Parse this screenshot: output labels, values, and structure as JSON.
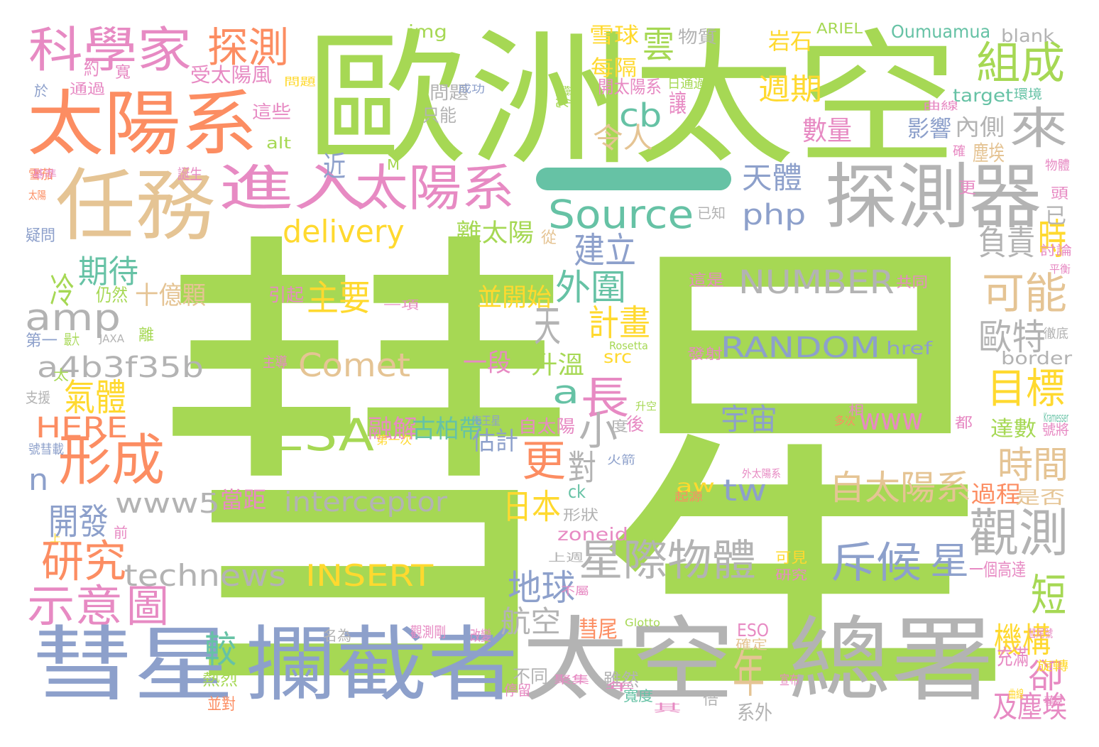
{
  "palette": {
    "green": "#a6d854",
    "teal": "#66c2a5",
    "orange": "#fc8d62",
    "blue": "#8da0cb",
    "pink": "#e78ac3",
    "yellow": "#ffd92f",
    "tan": "#e5c494",
    "gray": "#b3b3b3"
  },
  "words": [
    {
      "text": "彗星",
      "color": "#a6d854"
    },
    {
      "text": "歐洲太空",
      "color": "#a6d854"
    },
    {
      "text": "太陽系",
      "color": "#fc8d62"
    },
    {
      "text": "任務",
      "color": "#e5c494"
    },
    {
      "text": "探測器",
      "color": "#b3b3b3"
    },
    {
      "text": "科學家",
      "color": "#e78ac3"
    },
    {
      "text": "探測",
      "color": "#fc8d62"
    },
    {
      "text": "進入",
      "color": "#e78ac3"
    },
    {
      "text": "太陽系",
      "color": "#e78ac3"
    },
    {
      "text": "組成",
      "color": "#a6d854"
    },
    {
      "text": "來",
      "color": "#b3b3b3"
    },
    {
      "text": "彗星",
      "color": "#8da0cb"
    },
    {
      "text": "攔截者",
      "color": "#8da0cb"
    },
    {
      "text": "太空",
      "color": "#b3b3b3"
    },
    {
      "text": "總署",
      "color": "#b3b3b3"
    },
    {
      "text": "Source",
      "color": "#66c2a5"
    },
    {
      "text": "amp",
      "color": "#b3b3b3"
    },
    {
      "text": "a4b3f35b",
      "color": "#b3b3b3"
    },
    {
      "text": "ESA",
      "color": "#a6d854"
    },
    {
      "text": "形成",
      "color": "#fc8d62"
    },
    {
      "text": "NUMBER",
      "color": "#b3b3b3"
    },
    {
      "text": "RANDOM",
      "color": "#8da0cb"
    },
    {
      "text": "Comet",
      "color": "#e5c494"
    },
    {
      "text": "delivery",
      "color": "#ffd92f"
    },
    {
      "text": "interceptor",
      "color": "#b3b3b3"
    },
    {
      "text": "technews",
      "color": "#b3b3b3"
    },
    {
      "text": "INSERT",
      "color": "#ffd92f"
    },
    {
      "text": "www5",
      "color": "#b3b3b3"
    },
    {
      "text": "觀測",
      "color": "#b3b3b3"
    },
    {
      "text": "可能",
      "color": "#e5c494"
    },
    {
      "text": "目標",
      "color": "#ffd92f"
    },
    {
      "text": "時間",
      "color": "#e5c494"
    },
    {
      "text": "星際物體",
      "color": "#b3b3b3"
    },
    {
      "text": "斥候",
      "color": "#8da0cb"
    },
    {
      "text": "星",
      "color": "#8da0cb"
    },
    {
      "text": "自太陽系",
      "color": "#e5c494"
    },
    {
      "text": "示意",
      "color": "#e78ac3"
    },
    {
      "text": "圖",
      "color": "#e78ac3"
    },
    {
      "text": "研究",
      "color": "#fc8d62"
    },
    {
      "text": "HERE",
      "color": "#fc8d62"
    },
    {
      "text": "php",
      "color": "#8da0cb"
    },
    {
      "text": "cb",
      "color": "#66c2a5"
    },
    {
      "text": "雲",
      "color": "#a6d854"
    },
    {
      "text": "雪球",
      "color": "#ffd92f"
    },
    {
      "text": "週期",
      "color": "#ffd92f"
    },
    {
      "text": "天體",
      "color": "#8da0cb"
    },
    {
      "text": "長",
      "color": "#e78ac3"
    },
    {
      "text": "a",
      "color": "#66c2a5"
    },
    {
      "text": "小",
      "color": "#b3b3b3"
    },
    {
      "text": "更",
      "color": "#fc8d62"
    },
    {
      "text": "對",
      "color": "#b3b3b3"
    },
    {
      "text": "計畫",
      "color": "#ffd92f"
    },
    {
      "text": "天",
      "color": "#b3b3b3"
    },
    {
      "text": "外圍",
      "color": "#66c2a5"
    },
    {
      "text": "建立",
      "color": "#8da0cb"
    },
    {
      "text": "主要",
      "color": "#ffd92f"
    },
    {
      "text": "期待",
      "color": "#66c2a5"
    },
    {
      "text": "冷",
      "color": "#a6d854"
    },
    {
      "text": "氣體",
      "color": "#ffd92f"
    },
    {
      "text": "n",
      "color": "#8da0cb"
    },
    {
      "text": "開發",
      "color": "#8da0cb"
    },
    {
      "text": "地球",
      "color": "#8da0cb"
    },
    {
      "text": "航空",
      "color": "#b3b3b3"
    },
    {
      "text": "宇宙",
      "color": "#8da0cb"
    },
    {
      "text": "www",
      "color": "#e78ac3"
    },
    {
      "text": "tw",
      "color": "#8da0cb"
    },
    {
      "text": "日本",
      "color": "#ffd92f"
    },
    {
      "text": "歐特",
      "color": "#b3b3b3"
    },
    {
      "text": "時",
      "color": "#ffd92f"
    },
    {
      "text": "負責",
      "color": "#b3b3b3"
    },
    {
      "text": "短",
      "color": "#a6d854"
    },
    {
      "text": "機構",
      "color": "#ffd92f"
    },
    {
      "text": "卻",
      "color": "#e78ac3"
    },
    {
      "text": "及塵埃",
      "color": "#e78ac3"
    },
    {
      "text": "年",
      "color": "#e5c494"
    },
    {
      "text": "較",
      "color": "#66c2a5"
    },
    {
      "text": "img",
      "color": "#a6d854"
    },
    {
      "text": "blank",
      "color": "#b3b3b3"
    },
    {
      "text": "Oumuamua",
      "color": "#66c2a5"
    },
    {
      "text": "ARIEL",
      "color": "#a6d854"
    },
    {
      "text": "target",
      "color": "#66c2a5"
    },
    {
      "text": "岩石",
      "color": "#ffd92f"
    },
    {
      "text": "物質",
      "color": "#b3b3b3"
    },
    {
      "text": "每隔",
      "color": "#ffd92f"
    },
    {
      "text": "受太陽風",
      "color": "#e78ac3"
    },
    {
      "text": "這些",
      "color": "#e78ac3"
    },
    {
      "text": "令人",
      "color": "#e5c494"
    },
    {
      "text": "數量",
      "color": "#e78ac3"
    },
    {
      "text": "內側",
      "color": "#b3b3b3"
    },
    {
      "text": "影響",
      "color": "#8da0cb"
    },
    {
      "text": "塵埃",
      "color": "#e5c494"
    },
    {
      "text": "問題",
      "color": "#b3b3b3"
    },
    {
      "text": "只能",
      "color": "#b3b3b3"
    },
    {
      "text": "開太陽系",
      "color": "#e78ac3"
    },
    {
      "text": "日通過",
      "color": "#a6d854"
    },
    {
      "text": "讓",
      "color": "#e78ac3"
    },
    {
      "text": "近",
      "color": "#8da0cb"
    },
    {
      "text": "alt",
      "color": "#a6d854"
    },
    {
      "text": "M",
      "color": "#a6d854"
    },
    {
      "text": "離太陽",
      "color": "#a6d854"
    },
    {
      "text": "已知",
      "color": "#b3b3b3"
    },
    {
      "text": "仍然",
      "color": "#a6d854"
    },
    {
      "text": "十億顆",
      "color": "#e5c494"
    },
    {
      "text": "引起",
      "color": "#e78ac3"
    },
    {
      "text": "並開始",
      "color": "#ffd92f"
    },
    {
      "text": "這是",
      "color": "#e78ac3"
    },
    {
      "text": "共同",
      "color": "#e78ac3"
    },
    {
      "text": "href",
      "color": "#8da0cb"
    },
    {
      "text": "border",
      "color": "#b3b3b3"
    },
    {
      "text": "升溫",
      "color": "#a6d854"
    },
    {
      "text": "一段",
      "color": "#e78ac3"
    },
    {
      "text": "src",
      "color": "#ffd92f"
    },
    {
      "text": "Rosetta",
      "color": "#a6d854"
    },
    {
      "text": "融解",
      "color": "#e78ac3"
    },
    {
      "text": "古柏帶",
      "color": "#66c2a5"
    },
    {
      "text": "估計",
      "color": "#8da0cb"
    },
    {
      "text": "自太陽",
      "color": "#e78ac3"
    },
    {
      "text": "達數",
      "color": "#a6d854"
    },
    {
      "text": "當距",
      "color": "#e78ac3"
    },
    {
      "text": "過程",
      "color": "#fc8d62"
    },
    {
      "text": "是否",
      "color": "#e5c494"
    },
    {
      "text": "zoneid",
      "color": "#e78ac3"
    },
    {
      "text": "ck",
      "color": "#66c2a5"
    },
    {
      "text": "aw",
      "color": "#ffd92f"
    },
    {
      "text": "形狀",
      "color": "#b3b3b3"
    },
    {
      "text": "一個高達",
      "color": "#e78ac3"
    },
    {
      "text": "彗尾",
      "color": "#fc8d62"
    },
    {
      "text": "Glotto",
      "color": "#a6d854"
    },
    {
      "text": "ESO",
      "color": "#e78ac3"
    },
    {
      "text": "確定",
      "color": "#e5c494"
    },
    {
      "text": "充滿",
      "color": "#e78ac3"
    },
    {
      "text": "雖然",
      "color": "#b3b3b3"
    },
    {
      "text": "寬度",
      "color": "#66c2a5"
    },
    {
      "text": "系外",
      "color": "#b3b3b3"
    },
    {
      "text": "不同",
      "color": "#b3b3b3"
    },
    {
      "text": "熱烈",
      "color": "#a6d854"
    },
    {
      "text": "並對",
      "color": "#fc8d62"
    },
    {
      "text": "倍",
      "color": "#b3b3b3"
    },
    {
      "text": "第一",
      "color": "#8da0cb"
    },
    {
      "text": "JAXA",
      "color": "#b3b3b3"
    },
    {
      "text": "支援",
      "color": "#b3b3b3"
    },
    {
      "text": "主導",
      "color": "#e78ac3"
    },
    {
      "text": "離",
      "color": "#a6d854"
    },
    {
      "text": "疑問",
      "color": "#8da0cb"
    },
    {
      "text": "雪茄",
      "color": "#fc8d62"
    },
    {
      "text": "太陽",
      "color": "#fc8d62"
    },
    {
      "text": "於",
      "color": "#8da0cb"
    },
    {
      "text": "通過",
      "color": "#e78ac3"
    },
    {
      "text": "寬",
      "color": "#e78ac3"
    },
    {
      "text": "前",
      "color": "#e78ac3"
    },
    {
      "text": "上",
      "color": "#ffd92f"
    },
    {
      "text": "從",
      "color": "#e5c494"
    },
    {
      "text": "物體",
      "color": "#e78ac3"
    },
    {
      "text": "討論",
      "color": "#e78ac3"
    },
    {
      "text": "徹底",
      "color": "#b3b3b3"
    },
    {
      "text": "號將",
      "color": "#e78ac3"
    },
    {
      "text": "都",
      "color": "#e78ac3"
    },
    {
      "text": "多次",
      "color": "#fc8d62"
    },
    {
      "text": "度",
      "color": "#b3b3b3"
    },
    {
      "text": "後",
      "color": "#e78ac3"
    },
    {
      "text": "升空",
      "color": "#a6d854"
    },
    {
      "text": "火箭",
      "color": "#8da0cb"
    },
    {
      "text": "改變",
      "color": "#e78ac3"
    },
    {
      "text": "觀測剛",
      "color": "#e78ac3"
    },
    {
      "text": "名為",
      "color": "#b3b3b3"
    },
    {
      "text": "起源",
      "color": "#fc8d62"
    },
    {
      "text": "可見",
      "color": "#ffd92f"
    },
    {
      "text": "上週",
      "color": "#b3b3b3"
    },
    {
      "text": "不屬",
      "color": "#e78ac3"
    },
    {
      "text": "研究",
      "color": "#e78ac3"
    },
    {
      "text": "旋轉",
      "color": "#ffd92f"
    },
    {
      "text": "停留",
      "color": "#e78ac3"
    },
    {
      "text": "約",
      "color": "#e78ac3"
    },
    {
      "text": "問題",
      "color": "#ffd92f"
    },
    {
      "text": "成功",
      "color": "#8da0cb"
    },
    {
      "text": "變化",
      "color": "#a6d854"
    },
    {
      "text": "環境",
      "color": "#66c2a5"
    },
    {
      "text": "曲線",
      "color": "#e78ac3"
    },
    {
      "text": "頭",
      "color": "#e78ac3"
    },
    {
      "text": "誕生",
      "color": "#e78ac3"
    },
    {
      "text": "基準",
      "color": "#e78ac3"
    },
    {
      "text": "平衡",
      "color": "#e78ac3"
    },
    {
      "text": "已",
      "color": "#b3b3b3"
    },
    {
      "text": "發射",
      "color": "#e78ac3"
    },
    {
      "text": "Kramesser",
      "color": "#66c2a5"
    },
    {
      "text": "號彗載",
      "color": "#8da0cb"
    },
    {
      "text": "第一次",
      "color": "#ffd92f"
    },
    {
      "text": "海王星",
      "color": "#8da0cb"
    },
    {
      "text": "太",
      "color": "#a6d854"
    },
    {
      "text": "最大",
      "color": "#a6d854"
    },
    {
      "text": "一項",
      "color": "#e78ac3"
    },
    {
      "text": "外太陽系",
      "color": "#e78ac3"
    },
    {
      "text": "彗尾號",
      "color": "#e78ac3"
    },
    {
      "text": "聚集",
      "color": "#e78ac3"
    },
    {
      "text": "年",
      "color": "#e78ac3"
    },
    {
      "text": "其",
      "color": "#e78ac3"
    },
    {
      "text": "相",
      "color": "#e78ac3"
    },
    {
      "text": "宣布",
      "color": "#e78ac3"
    },
    {
      "text": "曲線",
      "color": "#ffd92f"
    },
    {
      "text": "觀",
      "color": "#e78ac3"
    },
    {
      "text": "更",
      "color": "#e78ac3"
    },
    {
      "text": "確",
      "color": "#e78ac3"
    }
  ]
}
